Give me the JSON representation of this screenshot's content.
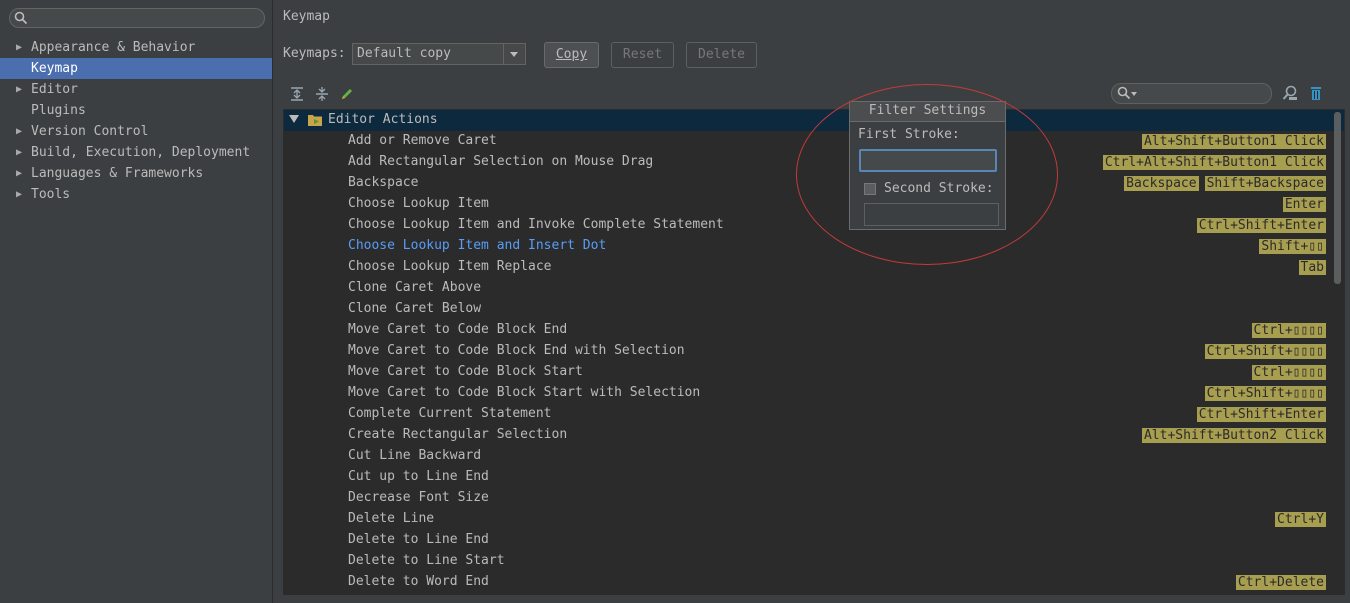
{
  "sidebar": {
    "search_placeholder": "",
    "items": [
      {
        "label": "Appearance & Behavior",
        "expandable": true,
        "selected": false
      },
      {
        "label": "Keymap",
        "expandable": false,
        "selected": true
      },
      {
        "label": "Editor",
        "expandable": true,
        "selected": false
      },
      {
        "label": "Plugins",
        "expandable": false,
        "selected": false
      },
      {
        "label": "Version Control",
        "expandable": true,
        "selected": false
      },
      {
        "label": "Build, Execution, Deployment",
        "expandable": true,
        "selected": false
      },
      {
        "label": "Languages & Frameworks",
        "expandable": true,
        "selected": false
      },
      {
        "label": "Tools",
        "expandable": true,
        "selected": false
      }
    ]
  },
  "header": {
    "title": "Keymap"
  },
  "keymaps": {
    "label": "Keymaps:",
    "selected": "Default copy",
    "copy_label": "Copy",
    "reset_label": "Reset",
    "delete_label": "Delete"
  },
  "toolbar": {
    "icons": [
      "expand-all-icon",
      "collapse-all-icon",
      "edit-icon",
      "find-shortcut-icon",
      "clear-filter-icon"
    ],
    "filter_value": ""
  },
  "tree": {
    "group_label": "Editor Actions",
    "rows": [
      {
        "name": "Add or Remove Caret",
        "shortcuts": [
          "Alt+Shift+Button1 Click"
        ]
      },
      {
        "name": "Add Rectangular Selection on Mouse Drag",
        "shortcuts": [
          "Ctrl+Alt+Shift+Button1 Click"
        ]
      },
      {
        "name": "Backspace",
        "shortcuts": [
          "Backspace",
          "Shift+Backspace"
        ]
      },
      {
        "name": "Choose Lookup Item",
        "shortcuts": [
          "Enter"
        ]
      },
      {
        "name": "Choose Lookup Item and Invoke Complete Statement",
        "shortcuts": [
          "Ctrl+Shift+Enter"
        ]
      },
      {
        "name": "Choose Lookup Item and Insert Dot",
        "shortcuts": [
          "Shift+▯▯"
        ],
        "highlight": true
      },
      {
        "name": "Choose Lookup Item Replace",
        "shortcuts": [
          "Tab"
        ]
      },
      {
        "name": "Clone Caret Above",
        "shortcuts": []
      },
      {
        "name": "Clone Caret Below",
        "shortcuts": []
      },
      {
        "name": "Move Caret to Code Block End",
        "shortcuts": [
          "Ctrl+▯▯▯▯"
        ]
      },
      {
        "name": "Move Caret to Code Block End with Selection",
        "shortcuts": [
          "Ctrl+Shift+▯▯▯▯"
        ]
      },
      {
        "name": "Move Caret to Code Block Start",
        "shortcuts": [
          "Ctrl+▯▯▯▯"
        ]
      },
      {
        "name": "Move Caret to Code Block Start with Selection",
        "shortcuts": [
          "Ctrl+Shift+▯▯▯▯"
        ]
      },
      {
        "name": "Complete Current Statement",
        "shortcuts": [
          "Ctrl+Shift+Enter"
        ]
      },
      {
        "name": "Create Rectangular Selection",
        "shortcuts": [
          "Alt+Shift+Button2 Click"
        ]
      },
      {
        "name": "Cut Line Backward",
        "shortcuts": []
      },
      {
        "name": "Cut up to Line End",
        "shortcuts": []
      },
      {
        "name": "Decrease Font Size",
        "shortcuts": []
      },
      {
        "name": "Delete Line",
        "shortcuts": [
          "Ctrl+Y"
        ]
      },
      {
        "name": "Delete to Line End",
        "shortcuts": []
      },
      {
        "name": "Delete to Line Start",
        "shortcuts": []
      },
      {
        "name": "Delete to Word End",
        "shortcuts": [
          "Ctrl+Delete"
        ]
      }
    ]
  },
  "filter_popup": {
    "title": "Filter Settings",
    "first_stroke_label": "First Stroke:",
    "first_stroke_value": "",
    "second_stroke_label": "Second Stroke:",
    "second_stroke_checked": false,
    "second_stroke_value": ""
  },
  "colors": {
    "background": "#3c3f41",
    "list_background": "#2b2b2b",
    "selection": "#4b6eaf",
    "shortcut_badge": "#a89e50",
    "highlight_text": "#589df6",
    "annotation_ellipse": "#c23b3b"
  }
}
